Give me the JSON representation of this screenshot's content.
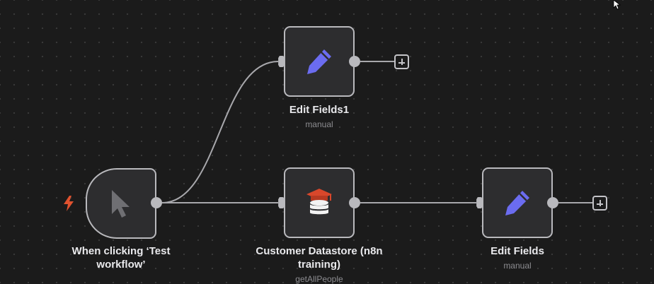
{
  "colors": {
    "canvas_bg": "#1b1b1b",
    "node_bg": "#2d2d2f",
    "node_border": "#b9b9bd",
    "edge": "#a8a8ac",
    "edit_icon": "#6b6cf0",
    "trigger_icon": "#e0522f",
    "subtitle": "#8c8c90"
  },
  "nodes": {
    "trigger": {
      "title": "When clicking ‘Test workflow’",
      "icon": "mouse-pointer-icon",
      "badge_icon": "lightning-bolt-icon"
    },
    "edit_fields_1": {
      "title": "Edit Fields1",
      "subtitle": "manual",
      "icon": "pencil-icon"
    },
    "customer_datastore": {
      "title": "Customer Datastore (n8n training)",
      "subtitle": "getAllPeople",
      "icon": "graduation-cap-database-icon"
    },
    "edit_fields": {
      "title": "Edit Fields",
      "subtitle": "manual",
      "icon": "pencil-icon"
    }
  },
  "connections": [
    {
      "from": "When clicking ‘Test workflow’",
      "to": "Edit Fields1"
    },
    {
      "from": "When clicking ‘Test workflow’",
      "to": "Customer Datastore (n8n training)"
    },
    {
      "from": "Customer Datastore (n8n training)",
      "to": "Edit Fields"
    }
  ]
}
